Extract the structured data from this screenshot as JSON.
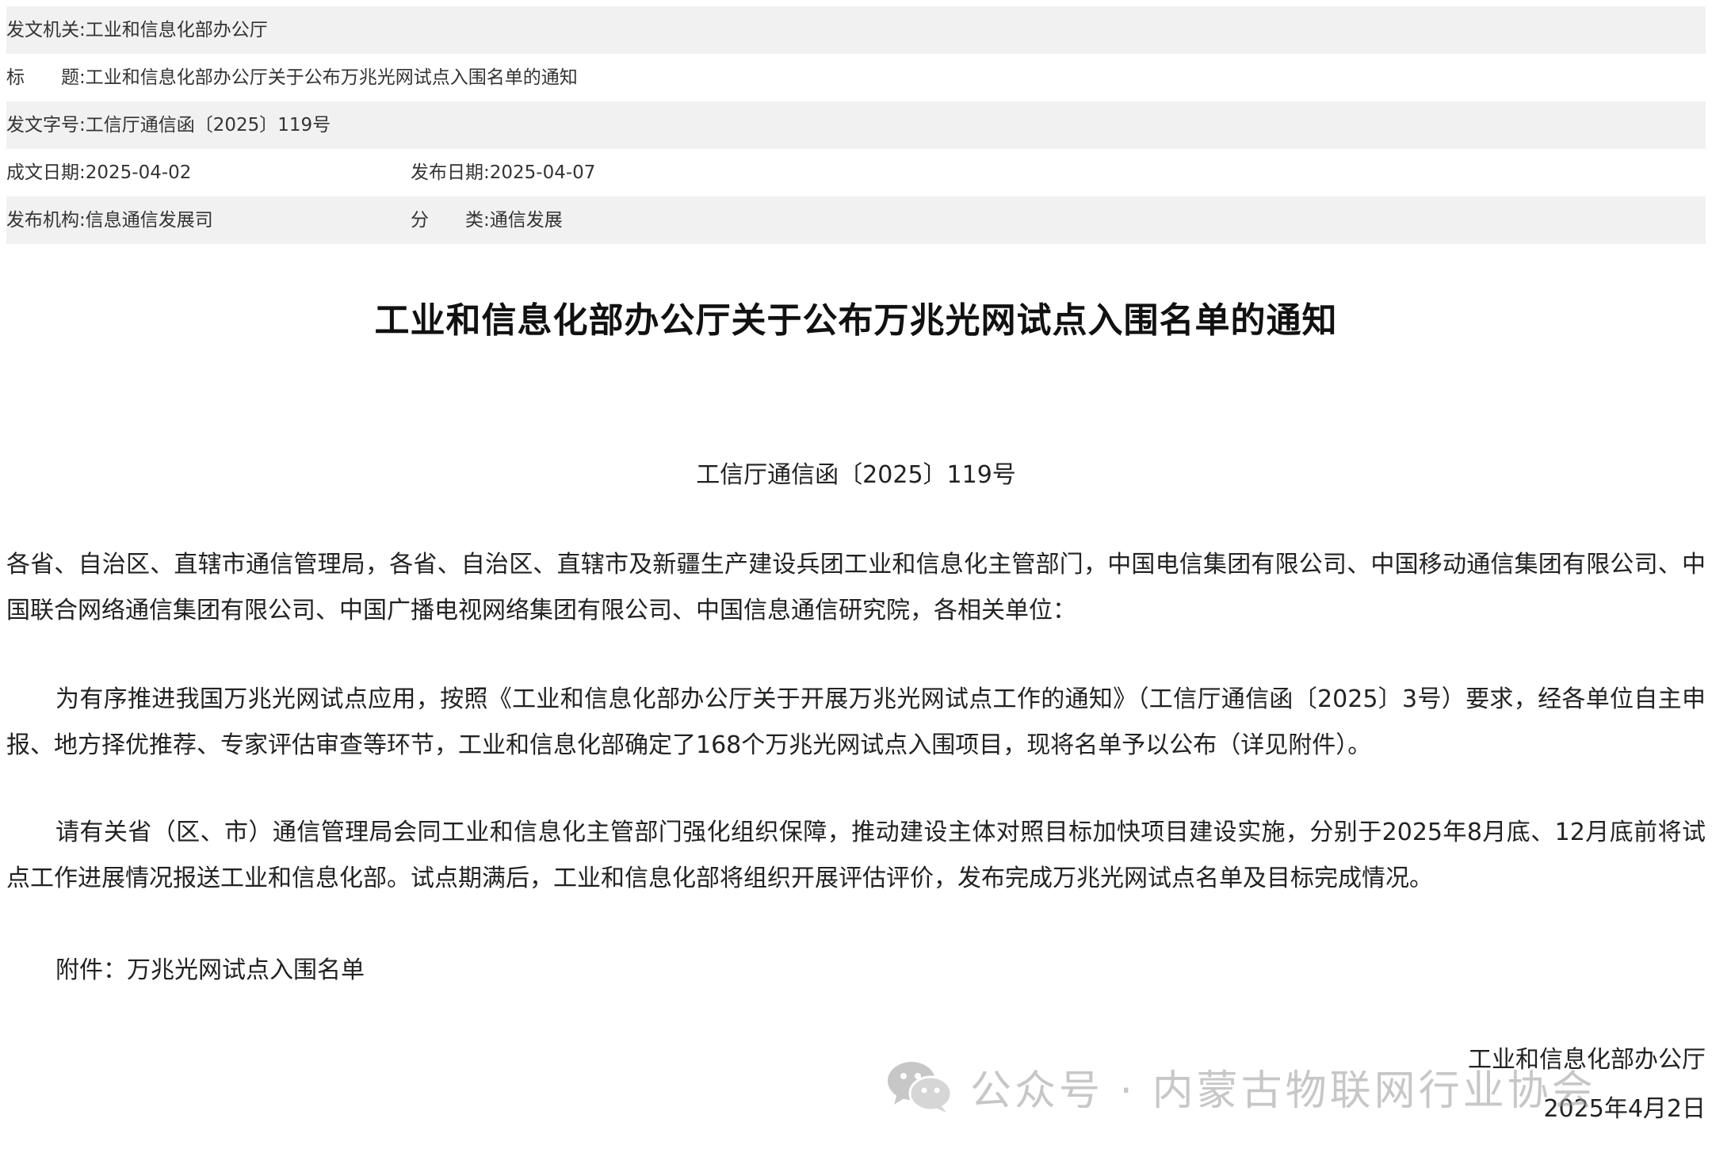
{
  "meta": {
    "issuer_label": "发文机关:",
    "issuer_value": "工业和信息化部办公厅",
    "title_label": "标　　题:",
    "title_value": "工业和信息化部办公厅关于公布万兆光网试点入围名单的通知",
    "docno_label": "发文字号:",
    "docno_value": "工信厅通信函〔2025〕119号",
    "written_label": "成文日期:",
    "written_value": "2025-04-02",
    "published_label": "发布日期:",
    "published_value": "2025-04-07",
    "agency_label": "发布机构:",
    "agency_value": "信息通信发展司",
    "category_label": "分　　类:",
    "category_value": "通信发展"
  },
  "document": {
    "title": "工业和信息化部办公厅关于公布万兆光网试点入围名单的通知",
    "number": "工信厅通信函〔2025〕119号",
    "addressee": "各省、自治区、直辖市通信管理局，各省、自治区、直辖市及新疆生产建设兵团工业和信息化主管部门，中国电信集团有限公司、中国移动通信集团有限公司、中国联合网络通信集团有限公司、中国广播电视网络集团有限公司、中国信息通信研究院，各相关单位：",
    "paragraph1": "为有序推进我国万兆光网试点应用，按照《工业和信息化部办公厅关于开展万兆光网试点工作的通知》（工信厅通信函〔2025〕3号）要求，经各单位自主申报、地方择优推荐、专家评估审查等环节，工业和信息化部确定了168个万兆光网试点入围项目，现将名单予以公布（详见附件）。",
    "paragraph2": "请有关省（区、市）通信管理局会同工业和信息化主管部门强化组织保障，推动建设主体对照目标加快项目建设实施，分别于2025年8月底、12月底前将试点工作进展情况报送工业和信息化部。试点期满后，工业和信息化部将组织开展评估评价，发布完成万兆光网试点名单及目标完成情况。",
    "attachment": "附件：万兆光网试点入围名单",
    "signature_org": "工业和信息化部办公厅",
    "signature_date": "2025年4月2日"
  },
  "watermark": {
    "icon": "wechat-icon",
    "text": "公众号 · 内蒙古物联网行业协会"
  }
}
